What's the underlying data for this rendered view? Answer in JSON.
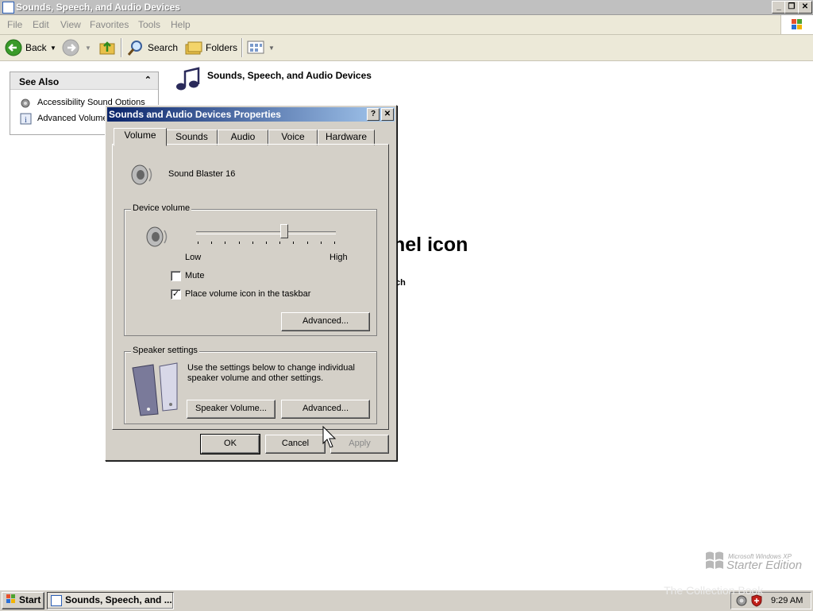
{
  "window": {
    "title": "Sounds, Speech, and Audio Devices"
  },
  "menu": [
    "File",
    "Edit",
    "View",
    "Favorites",
    "Tools",
    "Help"
  ],
  "toolbar": {
    "back": "Back",
    "search": "Search",
    "folders": "Folders"
  },
  "see_also": {
    "header": "See Also",
    "links": [
      "Accessibility Sound Options",
      "Advanced Volume"
    ]
  },
  "content": {
    "heading": "Sounds, Speech, and Audio Devices",
    "bg_heading_fragment": "nel icon",
    "bg_text_fragment": "ch"
  },
  "dialog": {
    "title": "Sounds and Audio Devices Properties",
    "tabs": [
      "Volume",
      "Sounds",
      "Audio",
      "Voice",
      "Hardware"
    ],
    "active_tab": "Volume",
    "device_name": "Sound Blaster 16",
    "device_volume": {
      "legend": "Device volume",
      "low": "Low",
      "high": "High",
      "level": 0.63,
      "mute_label": "Mute",
      "mute_checked": false,
      "taskbar_icon_label": "Place volume icon in the taskbar",
      "taskbar_icon_checked": true,
      "advanced_label": "Advanced..."
    },
    "speaker_settings": {
      "legend": "Speaker settings",
      "description": "Use the settings below to change individual speaker volume and other settings.",
      "speaker_volume_label": "Speaker Volume...",
      "advanced_label": "Advanced..."
    },
    "ok": "OK",
    "cancel": "Cancel",
    "apply": "Apply"
  },
  "watermark": {
    "line1": "Microsoft Windows XP",
    "line2": "Starter Edition",
    "faint": "The Collection Book"
  },
  "taskbar": {
    "start": "Start",
    "task": "Sounds, Speech, and ...",
    "clock": "9:29 AM"
  }
}
